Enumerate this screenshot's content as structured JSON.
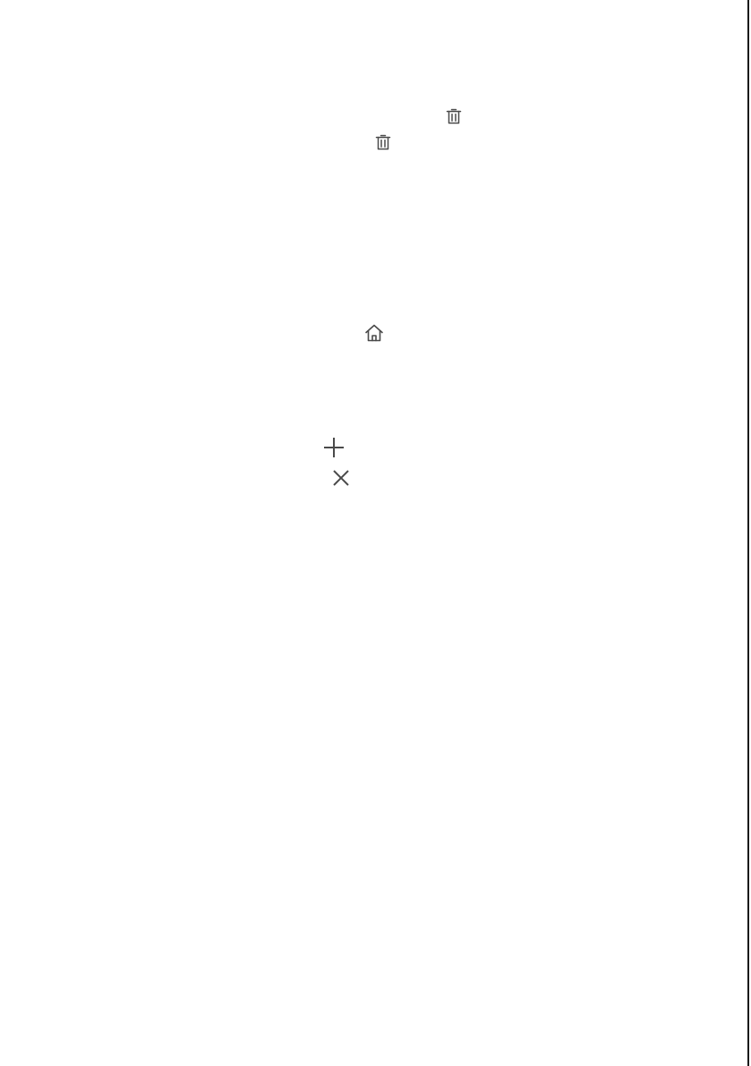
{
  "icons": {
    "trash": "trash-icon",
    "home": "home-icon",
    "add": "plus-icon",
    "close": "close-icon"
  },
  "colors": {
    "icon": "#4a4a4a",
    "background": "#ffffff",
    "edge_line": "#1a1a1a"
  }
}
